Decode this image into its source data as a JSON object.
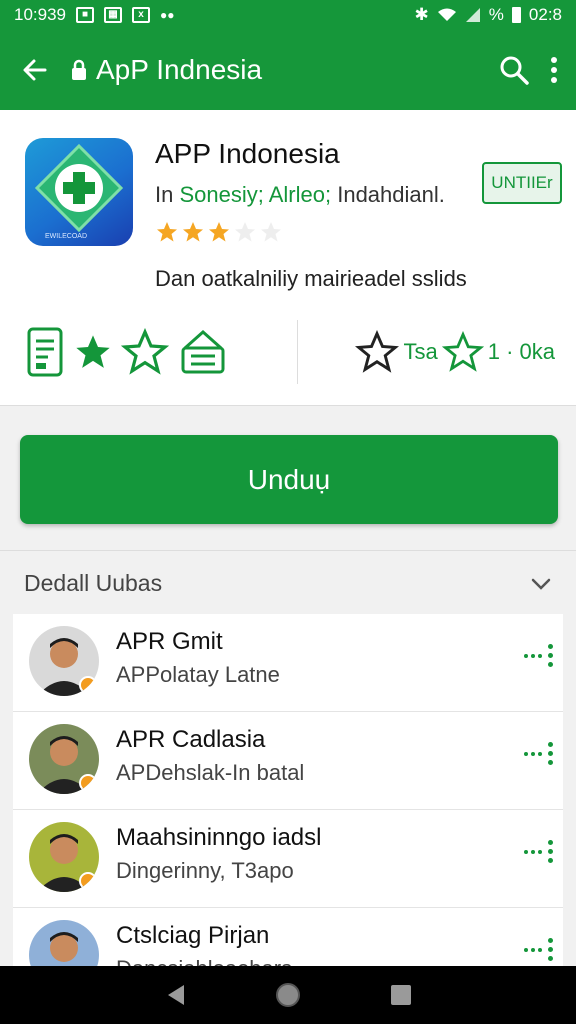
{
  "status_bar": {
    "time": "10:939",
    "battery_percent": "%",
    "right_time": "02:8"
  },
  "app_bar": {
    "title": "ApP Indnesia"
  },
  "app": {
    "name": "APP Indonesia",
    "developer_prefix": "In ",
    "developer_green": "Sonesiy; Alrleo;",
    "developer_suffix": " Indahdianl.",
    "badge": "UNTIIEr",
    "rating_value": 3,
    "rating_max": 5,
    "icon_subtext": "EWILECOAD",
    "description": "Dan oatkalniliy mairieadel sslids"
  },
  "rating_summary": {
    "text1": "Tsa",
    "text2": "1 · 0ka"
  },
  "download_button": {
    "label": "Unduụ"
  },
  "section": {
    "label": "Dedall Uubas"
  },
  "reviews": [
    {
      "name": "APR Gmit",
      "subtitle": "APPolatay Latne",
      "avatar_bg": "#d9d9d9"
    },
    {
      "name": "APR Cadlasia",
      "subtitle": "APDehslak-In batal",
      "avatar_bg": "#7b8c5a"
    },
    {
      "name": "Maahsininngo iadsl",
      "subtitle": "Dingerinny, T3apo",
      "avatar_bg": "#a8b53a"
    },
    {
      "name": "Ctslciag Pirjan",
      "subtitle": "Dancsiabloaebars...",
      "avatar_bg": "#8fb0d8"
    }
  ],
  "colors": {
    "primary_green": "#15973a",
    "star_gold": "#f5a623"
  }
}
